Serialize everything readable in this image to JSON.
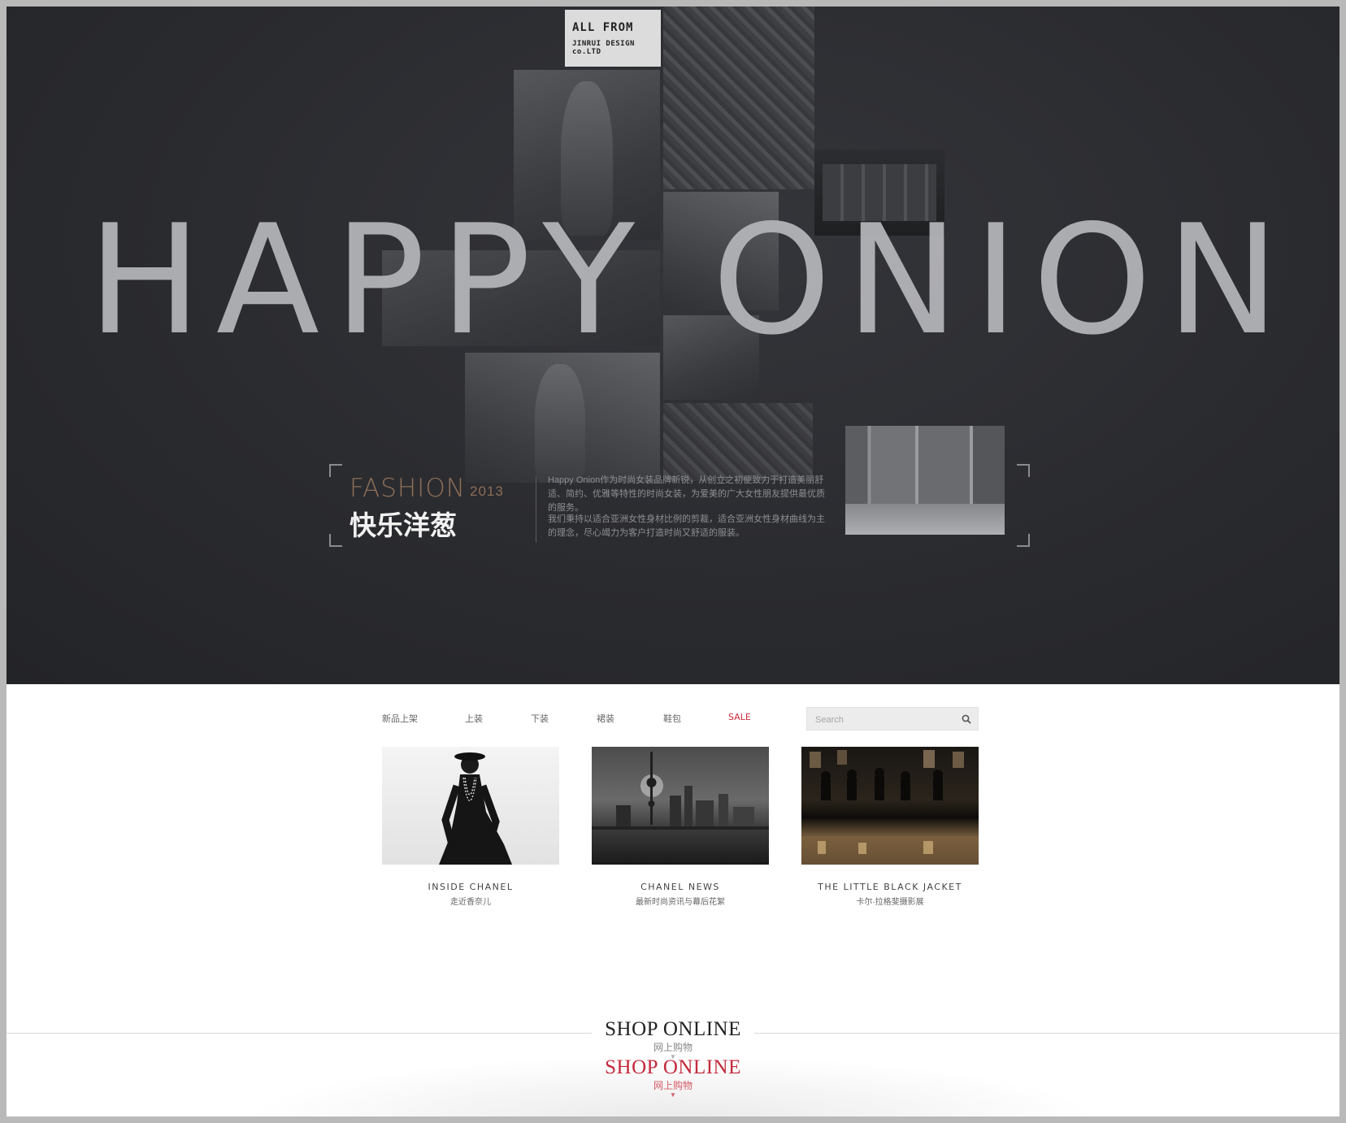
{
  "hero": {
    "tag_line1": "ALL FROM",
    "tag_line2": "JINRUI DESIGN co.LTD",
    "brand": "HAPPY ONION",
    "fashion": "FASHION",
    "year": "2013",
    "title_cn": "快乐洋葱",
    "intro_p1": "Happy Onion作为时尚女装品牌新锐，从创立之初便致力于打造美丽舒适、简约、优雅等特性的时尚女装，为爱美的广大女性朋友提供最优质的服务。",
    "intro_p2": "我们秉持以适合亚洲女性身材比例的剪裁，适合亚洲女性身材曲线为主的理念，尽心竭力为客户打造时尚又舒适的服装。"
  },
  "nav": {
    "items": [
      "新品上架",
      "上装",
      "下装",
      "裙装",
      "鞋包",
      "SALE"
    ],
    "sale_color": "#d0293a"
  },
  "search": {
    "placeholder": "Search",
    "icon": "search-icon"
  },
  "cards": [
    {
      "title": "INSIDE CHANEL",
      "subtitle": "走近香奈儿"
    },
    {
      "title": "CHANEL NEWS",
      "subtitle": "最新时尚资讯与幕后花絮"
    },
    {
      "title": "THE LITTLE BLACK JACKET",
      "subtitle": "卡尔·拉格斐摄影展"
    }
  ],
  "shop": [
    {
      "en": "SHOP ONLINE",
      "cn": "网上购物",
      "state": "normal"
    },
    {
      "en": "SHOP ONLINE",
      "cn": "网上购物",
      "state": "active"
    }
  ],
  "colors": {
    "hero_bg": "#2a2b2f",
    "accent_red": "#c42a3c",
    "fashion_brown": "#8d6e57"
  }
}
